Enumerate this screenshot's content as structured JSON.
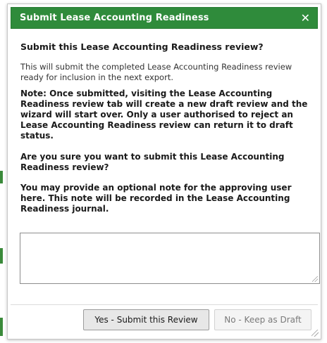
{
  "dialog": {
    "title": "Submit Lease Accounting Readiness",
    "close_icon": "close-icon",
    "heading": "Submit this Lease Accounting Readiness review?",
    "description": "This will submit the completed Lease Accounting Readiness review ready for inclusion in the next export.",
    "note_warning": "Note: Once submitted, visiting the Lease Accounting Readiness review tab will create a new draft review and the wizard will start over. Only a user authorised to reject an Lease Accounting Readiness review can return it to draft status.",
    "confirm_question": "Are you sure you want to submit this Lease Accounting Readiness review?",
    "note_prompt": "You may provide an optional note for the approving user here. This note will be recorded in the Lease Accounting Readiness journal.",
    "note_value": "",
    "buttons": {
      "submit": "Yes - Submit this Review",
      "keep_draft": "No - Keep as Draft"
    }
  },
  "colors": {
    "titlebar": "#2f8b3b",
    "title_text": "#ffffff",
    "background_strip": "#3a8a3a"
  }
}
